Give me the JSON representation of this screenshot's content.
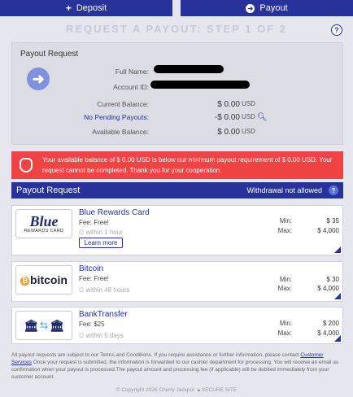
{
  "tabs": {
    "deposit": "Deposit",
    "payout": "Payout"
  },
  "step_title": "REQUEST A PAYOUT: STEP 1 OF 2",
  "help_symbol": "?",
  "summary": {
    "section_title": "Payout Request",
    "full_name_label": "Full Name:",
    "account_id_label": "Account ID:",
    "current_balance_label": "Current Balance:",
    "current_balance": "$ 0.00",
    "pending_label": "No Pending Payouts:",
    "pending_value": "-$ 0.00",
    "available_label": "Available Balance:",
    "available_value": "$ 0.00",
    "currency": "USD"
  },
  "alert": {
    "text": "Your available balance of $ 0.00 USD is below our minimum payout requirement of $ 0.00 USD. Your request cannot be completed. Thank you for your cooperation."
  },
  "payout_header": {
    "title": "Payout Request",
    "status": "Withdrawal not allowed"
  },
  "methods": [
    {
      "name": "Blue Rewards Card",
      "fee": "Fee: Free!",
      "time": "within 1 hour",
      "learn_more": "Learn more",
      "min_label": "Min:",
      "min": "$ 35",
      "max_label": "Max:",
      "max": "$ 4,000",
      "logo_big": "Blue",
      "logo_small": "REWARDS CARD"
    },
    {
      "name": "Bitcoin",
      "fee": "Fee: Free!",
      "time": "within 48 hours",
      "min_label": "Min:",
      "min": "$ 30",
      "max_label": "Max:",
      "max": "$ 4,000",
      "logo_text": "bitcoin",
      "logo_symbol": "₿"
    },
    {
      "name": "BankTransfer",
      "fee": "Fee: $25",
      "time": "within 5 days",
      "min_label": "Min:",
      "min": "$ 200",
      "max_label": "Max:",
      "max": "$ 4,000"
    }
  ],
  "disclaimer": {
    "text_a": "All payout requests are subject to our Terms and Conditions. If you require assistance or further information, please contact ",
    "link": "Customer Services",
    "text_b": " Once your request is submitted, the information is forwarded to our cashier department for processing. You will receive an email as confirmation when your payout is processed.The payout amount and processing fee (if applicable) will be debited immediately from your customer account."
  },
  "footer": {
    "copyright": "© Copyright 2026 Cherry Jackpot",
    "secure": "SECURE SITE"
  },
  "colors": {
    "brand": "#27339a",
    "alert": "#f04343",
    "background": "#e6e6ee"
  }
}
